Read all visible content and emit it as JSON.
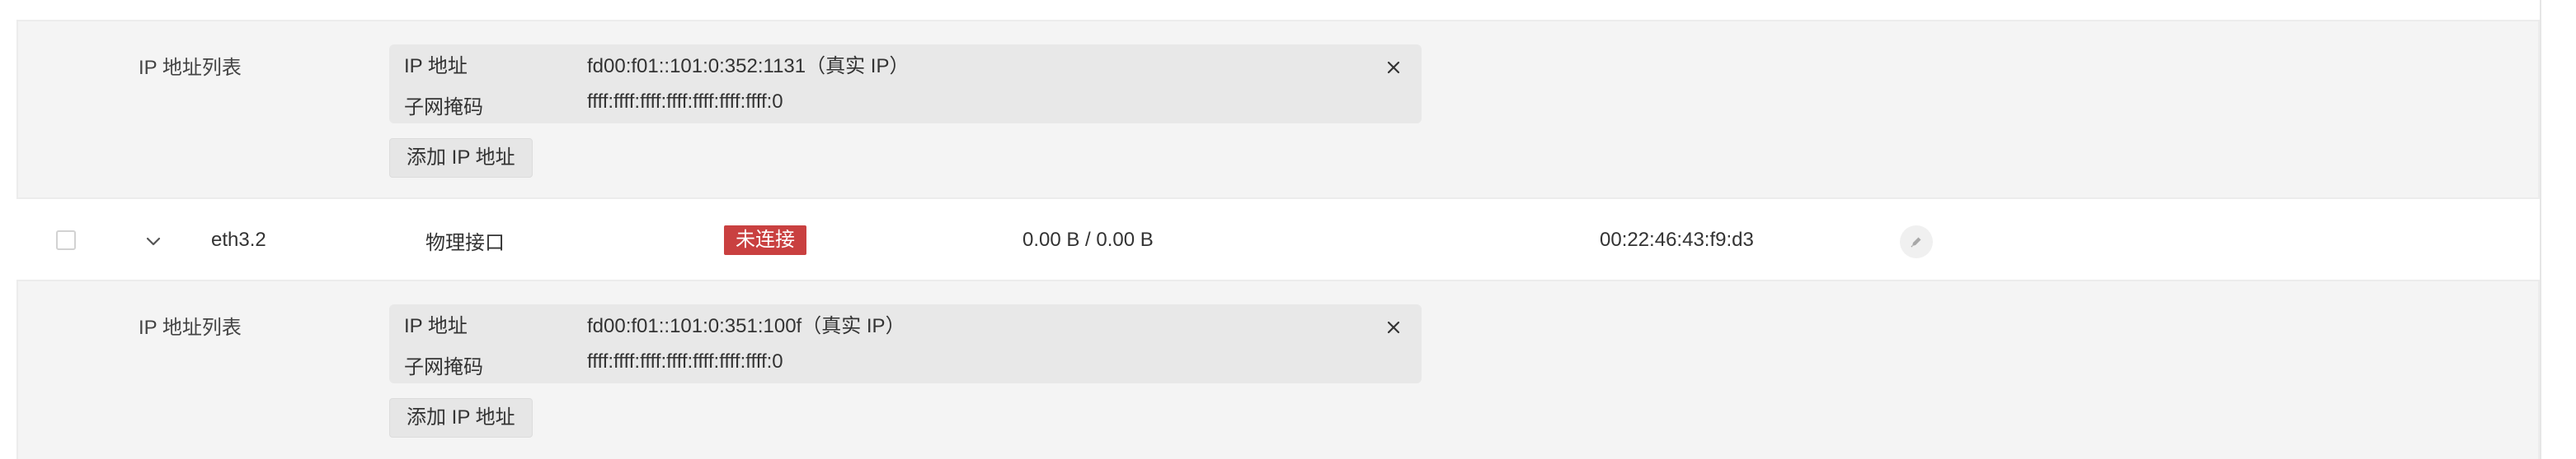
{
  "panels": [
    {
      "label": "IP 地址列表",
      "ip_label": "IP 地址",
      "ip_value": "fd00:f01::101:0:352:1131（真实 IP）",
      "mask_label": "子网掩码",
      "mask_value": "ffff:ffff:ffff:ffff:ffff:ffff:ffff:0",
      "add_button": "添加 IP 地址"
    },
    {
      "label": "IP 地址列表",
      "ip_label": "IP 地址",
      "ip_value": "fd00:f01::101:0:351:100f（真实 IP）",
      "mask_label": "子网掩码",
      "mask_value": "ffff:ffff:ffff:ffff:ffff:ffff:ffff:0",
      "add_button": "添加 IP 地址"
    }
  ],
  "interface": {
    "name": "eth3.2",
    "type": "物理接口",
    "status": "未连接",
    "status_color": "#c94040",
    "traffic": "0.00 B / 0.00 B",
    "mac": "00:22:46:43:f9:d3"
  },
  "icons": {
    "remove": "close-icon",
    "expand": "chevron-down-icon",
    "edit": "pencil-icon"
  }
}
